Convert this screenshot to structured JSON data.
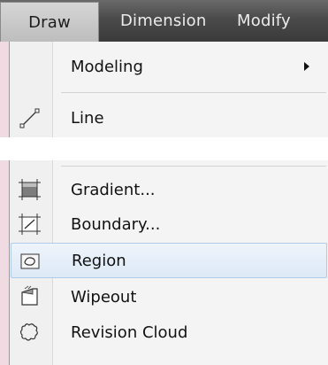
{
  "menubar": {
    "items": [
      {
        "label": "Draw"
      },
      {
        "label": "Dimension"
      },
      {
        "label": "Modify"
      }
    ]
  },
  "dropdown": {
    "modeling": {
      "label": "Modeling",
      "icon": "none",
      "has_submenu": true
    },
    "line": {
      "label": "Line",
      "icon": "line-icon"
    },
    "gradient": {
      "label": "Gradient...",
      "icon": "gradient-icon"
    },
    "boundary": {
      "label": "Boundary...",
      "icon": "boundary-icon"
    },
    "region": {
      "label": "Region",
      "icon": "region-icon",
      "highlighted": true
    },
    "wipeout": {
      "label": "Wipeout",
      "icon": "wipeout-icon"
    },
    "revision_cloud": {
      "label": "Revision Cloud",
      "icon": "revision-cloud-icon"
    }
  },
  "colors": {
    "menubar_bg": "#4a4a4a",
    "active_menu_bg": "#c8c8c8",
    "dropdown_bg": "#f4f4f4",
    "highlight_bg": "#dde9f6",
    "highlight_border": "#aecbe9",
    "page_bg": "#f3dde3"
  }
}
